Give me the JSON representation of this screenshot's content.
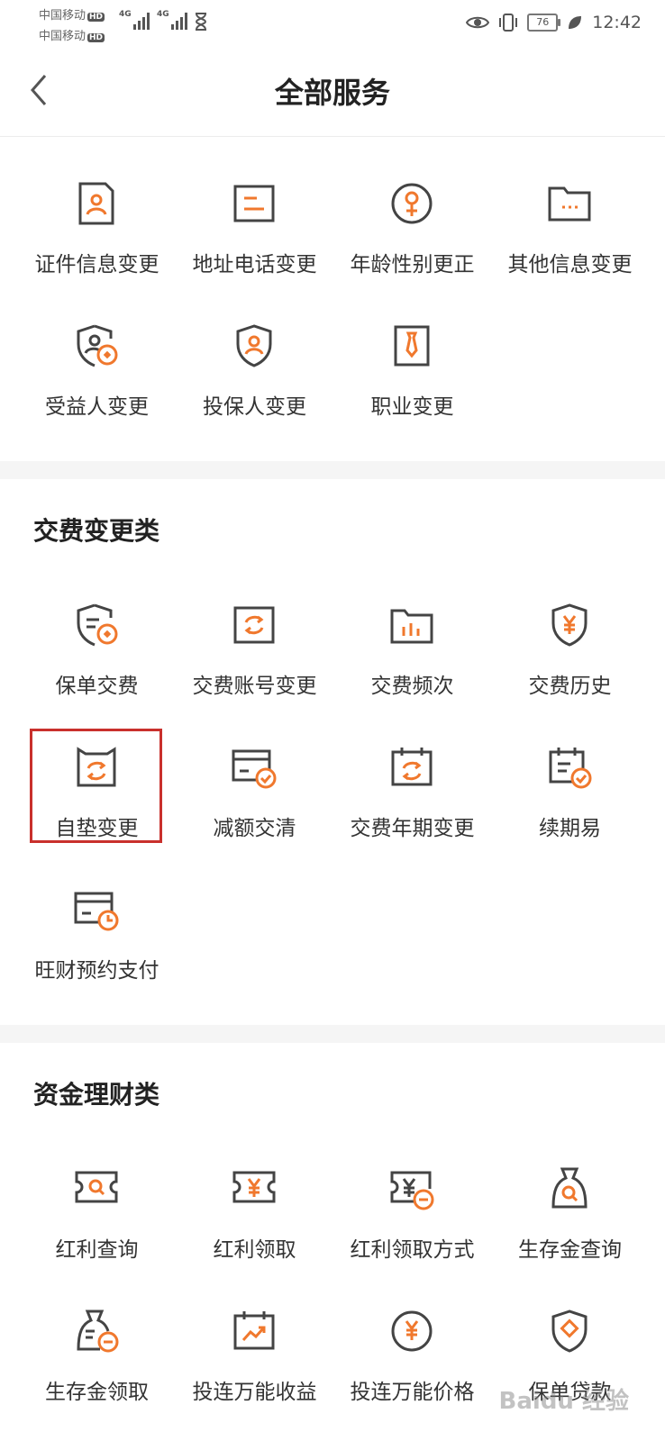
{
  "status_bar": {
    "carrier1": "中国移动",
    "carrier2": "中国移动",
    "hd_badge": "HD",
    "network": "4G",
    "battery": "76",
    "time": "12:42"
  },
  "nav": {
    "title": "全部服务",
    "back_icon": "chevron-left-icon"
  },
  "colors": {
    "accent": "#f0782d",
    "icon_stroke": "#444444",
    "highlight": "#c9302c"
  },
  "sections": {
    "personal": {
      "items": [
        {
          "label": "证件信息变更",
          "icon": "id-card-icon"
        },
        {
          "label": "地址电话变更",
          "icon": "address-card-icon"
        },
        {
          "label": "年龄性别更正",
          "icon": "gender-icon"
        },
        {
          "label": "其他信息变更",
          "icon": "folder-icon"
        },
        {
          "label": "受益人变更",
          "icon": "beneficiary-shield-icon"
        },
        {
          "label": "投保人变更",
          "icon": "policyholder-shield-icon"
        },
        {
          "label": "职业变更",
          "icon": "occupation-tie-icon"
        }
      ]
    },
    "payment": {
      "title": "交费变更类",
      "items": [
        {
          "label": "保单交费",
          "icon": "policy-payment-icon"
        },
        {
          "label": "交费账号变更",
          "icon": "account-switch-icon"
        },
        {
          "label": "交费频次",
          "icon": "frequency-chart-icon"
        },
        {
          "label": "交费历史",
          "icon": "yuan-shield-icon"
        },
        {
          "label": "自垫变更",
          "icon": "self-advance-icon"
        },
        {
          "label": "减额交清",
          "icon": "card-check-icon"
        },
        {
          "label": "交费年期变更",
          "icon": "calendar-switch-icon"
        },
        {
          "label": "续期易",
          "icon": "renewal-check-icon"
        },
        {
          "label": "旺财预约支付",
          "icon": "card-clock-icon"
        }
      ]
    },
    "finance": {
      "title": "资金理财类",
      "items": [
        {
          "label": "红利查询",
          "icon": "ticket-search-icon"
        },
        {
          "label": "红利领取",
          "icon": "ticket-yuan-icon"
        },
        {
          "label": "红利领取方式",
          "icon": "ticket-yuan-minus-icon"
        },
        {
          "label": "生存金查询",
          "icon": "moneybag-search-icon"
        },
        {
          "label": "生存金领取",
          "icon": "moneybag-minus-icon"
        },
        {
          "label": "投连万能收益",
          "icon": "calendar-trend-icon"
        },
        {
          "label": "投连万能价格",
          "icon": "yuan-circle-icon"
        },
        {
          "label": "保单贷款",
          "icon": "loan-shield-icon"
        }
      ]
    }
  },
  "watermark": "Baidu 经验"
}
